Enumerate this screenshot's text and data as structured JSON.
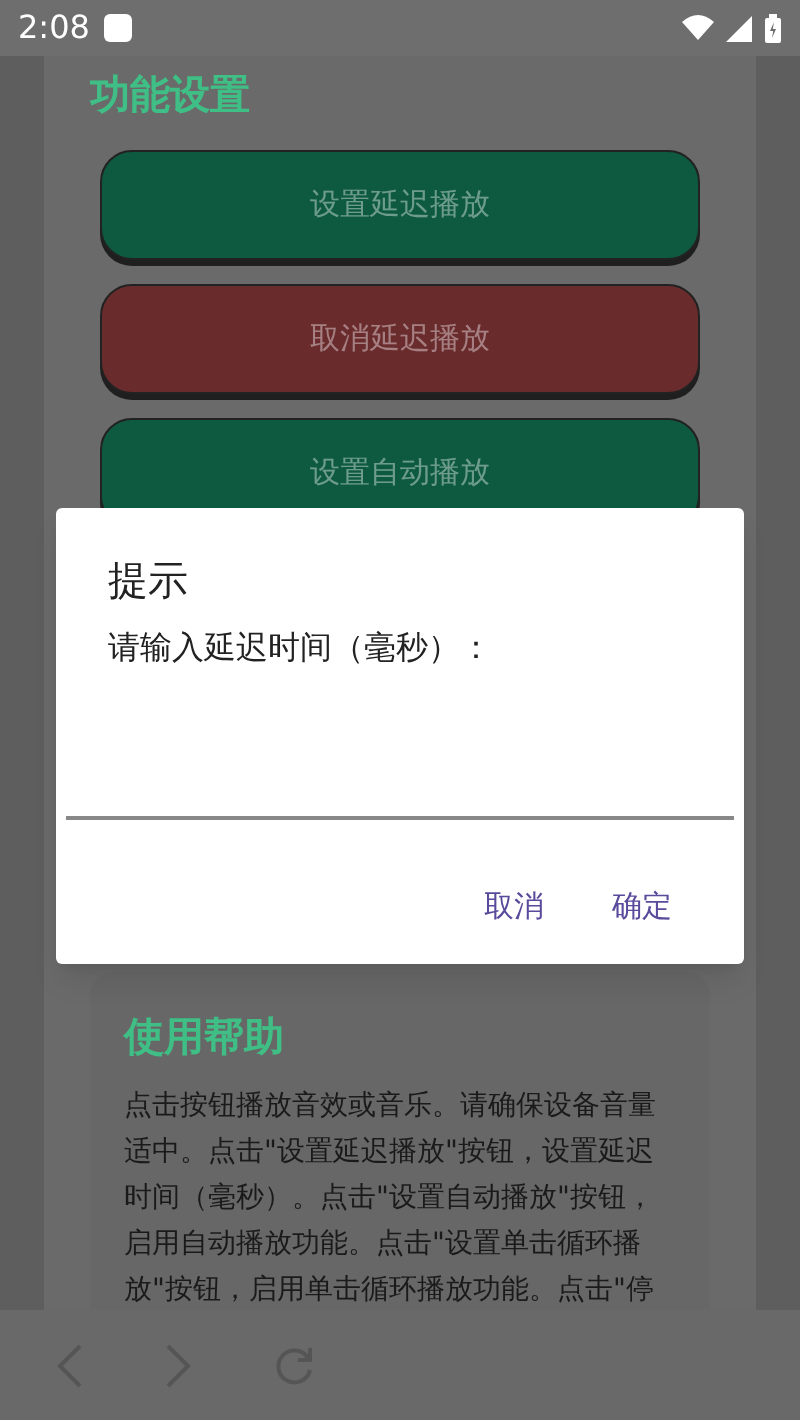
{
  "status_bar": {
    "time": "2:08"
  },
  "settings": {
    "title": "功能设置",
    "buttons": [
      {
        "label": "设置延迟播放",
        "color": "#0e5a40"
      },
      {
        "label": "取消延迟播放",
        "color": "#6a2b2d"
      },
      {
        "label": "设置自动播放",
        "color": "#0e5a40"
      }
    ]
  },
  "help": {
    "title": "使用帮助",
    "text": "点击按钮播放音效或音乐。请确保设备音量适中。点击\"设置延迟播放\"按钮，设置延迟时间（毫秒）。点击\"设置自动播放\"按钮，启用自动播放功能。点击\"设置单击循环播放\"按钮，启用单击循环播放功能。点击\"停"
  },
  "dialog": {
    "title": "提示",
    "message": "请输入延迟时间（毫秒）：",
    "buttons": [
      "取消",
      "确定"
    ]
  }
}
